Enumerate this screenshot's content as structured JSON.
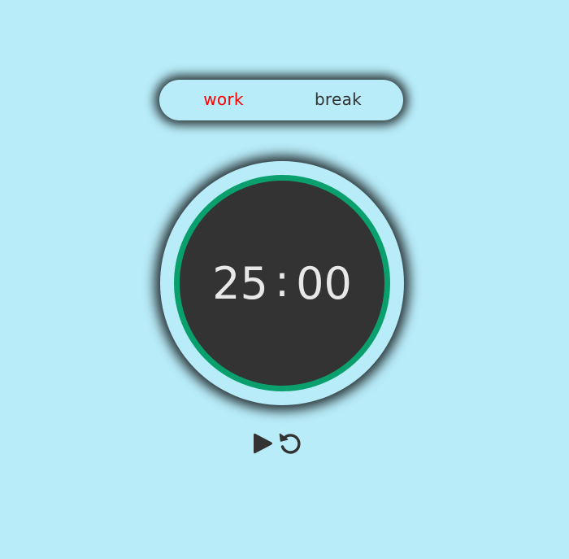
{
  "colors": {
    "background": "#b8ecf9",
    "active_mode": "#ff0000",
    "inactive_mode": "#333333",
    "progress_ring": "#0aa06e",
    "timer_face": "#333333",
    "timer_text": "#e8e8e8",
    "icon": "#333333"
  },
  "mode_toggle": {
    "work_label": "work",
    "break_label": "break",
    "active": "work"
  },
  "timer": {
    "minutes": "25",
    "separator": ":",
    "seconds": "00",
    "progress": 1.0
  },
  "controls": {
    "play_icon": "play-icon",
    "reset_icon": "reset-icon"
  }
}
